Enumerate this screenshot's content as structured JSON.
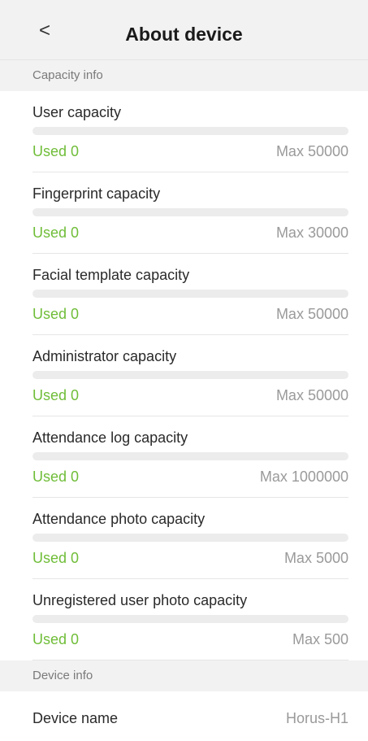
{
  "header": {
    "back_icon": "<",
    "title": "About device"
  },
  "capacity_section": {
    "label": "Capacity info",
    "items": [
      {
        "label": "User capacity",
        "used": "Used 0",
        "max": "Max 50000",
        "used_fraction": 0
      },
      {
        "label": "Fingerprint capacity",
        "used": "Used 0",
        "max": "Max 30000",
        "used_fraction": 0
      },
      {
        "label": "Facial template capacity",
        "used": "Used 0",
        "max": "Max 50000",
        "used_fraction": 0
      },
      {
        "label": "Administrator capacity",
        "used": "Used 0",
        "max": "Max 50000",
        "used_fraction": 0
      },
      {
        "label": "Attendance log capacity",
        "used": "Used 0",
        "max": "Max 1000000",
        "used_fraction": 0
      },
      {
        "label": "Attendance photo capacity",
        "used": "Used 0",
        "max": "Max 5000",
        "used_fraction": 0
      },
      {
        "label": "Unregistered user photo capacity",
        "used": "Used 0",
        "max": "Max 500",
        "used_fraction": 0
      }
    ]
  },
  "device_section": {
    "label": "Device info",
    "device_name_label": "Device name",
    "device_name_value": "Horus-H1"
  },
  "colors": {
    "used": "#6fbd38",
    "max": "#9a9a9a",
    "section_bg": "#f2f2f2"
  }
}
